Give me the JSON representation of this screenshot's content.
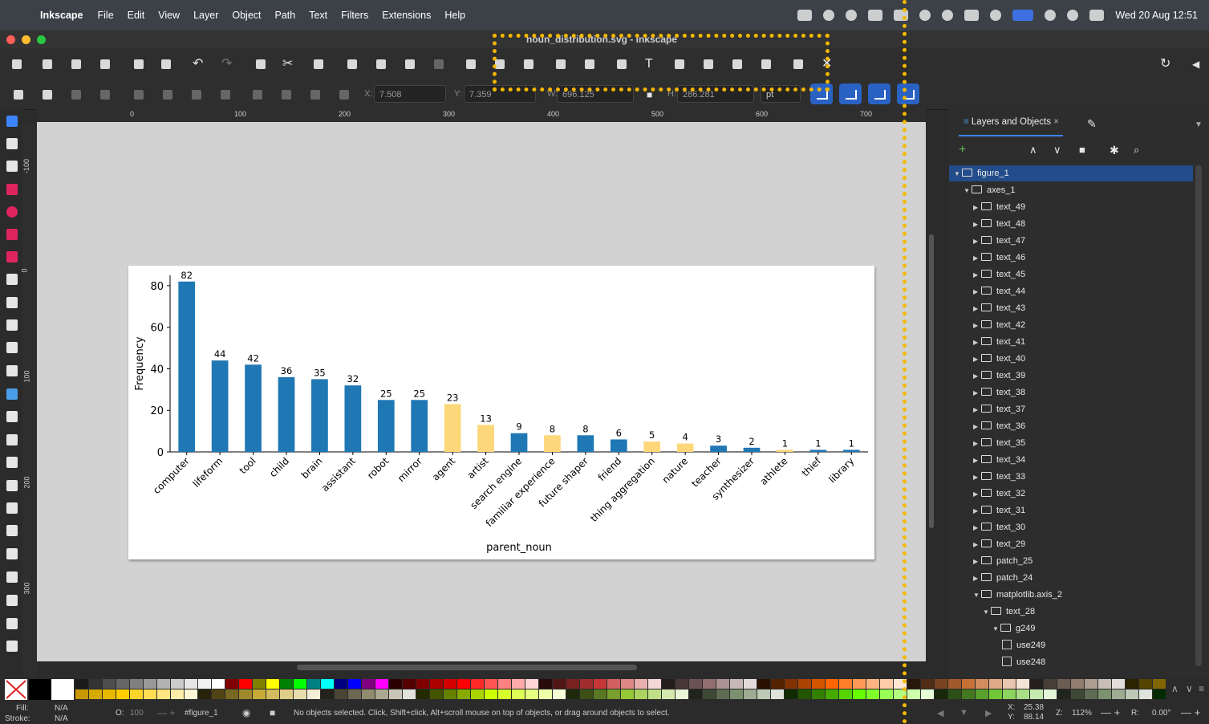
{
  "menubar": {
    "app_name": "Inkscape",
    "items": [
      "File",
      "Edit",
      "View",
      "Layer",
      "Object",
      "Path",
      "Text",
      "Filters",
      "Extensions",
      "Help"
    ],
    "clock": "Wed 20 Aug  12:51"
  },
  "window": {
    "title": "noun_distribution.svg - Inkscape"
  },
  "controls": {
    "x_label": "X:",
    "x_value": "7.508",
    "y_label": "Y:",
    "y_value": "7.359",
    "w_label": "W:",
    "w_value": "696.125",
    "h_label": "H:",
    "h_value": "286.281",
    "unit": "pt"
  },
  "rulers": {
    "top": [
      "0",
      "100",
      "200",
      "300",
      "400",
      "500",
      "600",
      "700"
    ],
    "left": [
      "-100",
      "0",
      "100",
      "200",
      "300"
    ]
  },
  "chart_data": {
    "type": "bar",
    "xlabel": "parent_noun",
    "ylabel": "Frequency",
    "ylim": [
      0,
      85
    ],
    "yticks": [
      0,
      20,
      40,
      60,
      80
    ],
    "grid": false,
    "categories": [
      "computer",
      "lifeform",
      "tool",
      "child",
      "brain",
      "assistant",
      "robot",
      "mirror",
      "agent",
      "artist",
      "search engine",
      "familiar experience",
      "future shaper",
      "friend",
      "thing aggregation",
      "nature",
      "teacher",
      "synthesizer",
      "athlete",
      "thief",
      "library"
    ],
    "values": [
      82,
      44,
      42,
      36,
      35,
      32,
      25,
      25,
      23,
      13,
      9,
      8,
      8,
      6,
      5,
      4,
      3,
      2,
      1,
      1,
      1
    ],
    "bar_colors": [
      "#1f77b4",
      "#1f77b4",
      "#1f77b4",
      "#1f77b4",
      "#1f77b4",
      "#1f77b4",
      "#1f77b4",
      "#1f77b4",
      "#fdd77a",
      "#fdd77a",
      "#1f77b4",
      "#fdd77a",
      "#1f77b4",
      "#1f77b4",
      "#fdd77a",
      "#fdd77a",
      "#1f77b4",
      "#1f77b4",
      "#fdd77a",
      "#1f77b4",
      "#1f77b4"
    ]
  },
  "panel": {
    "tab_label": "Layers and Objects",
    "tree": [
      {
        "label": "figure_1",
        "depth": 0,
        "expanded": true,
        "selected": true,
        "kind": "group"
      },
      {
        "label": "axes_1",
        "depth": 1,
        "expanded": true,
        "kind": "group"
      },
      {
        "label": "text_49",
        "depth": 2,
        "kind": "group"
      },
      {
        "label": "text_48",
        "depth": 2,
        "kind": "group"
      },
      {
        "label": "text_47",
        "depth": 2,
        "kind": "group"
      },
      {
        "label": "text_46",
        "depth": 2,
        "kind": "group"
      },
      {
        "label": "text_45",
        "depth": 2,
        "kind": "group"
      },
      {
        "label": "text_44",
        "depth": 2,
        "kind": "group"
      },
      {
        "label": "text_43",
        "depth": 2,
        "kind": "group"
      },
      {
        "label": "text_42",
        "depth": 2,
        "kind": "group"
      },
      {
        "label": "text_41",
        "depth": 2,
        "kind": "group"
      },
      {
        "label": "text_40",
        "depth": 2,
        "kind": "group"
      },
      {
        "label": "text_39",
        "depth": 2,
        "kind": "group"
      },
      {
        "label": "text_38",
        "depth": 2,
        "kind": "group"
      },
      {
        "label": "text_37",
        "depth": 2,
        "kind": "group"
      },
      {
        "label": "text_36",
        "depth": 2,
        "kind": "group"
      },
      {
        "label": "text_35",
        "depth": 2,
        "kind": "group"
      },
      {
        "label": "text_34",
        "depth": 2,
        "kind": "group"
      },
      {
        "label": "text_33",
        "depth": 2,
        "kind": "group"
      },
      {
        "label": "text_32",
        "depth": 2,
        "kind": "group"
      },
      {
        "label": "text_31",
        "depth": 2,
        "kind": "group"
      },
      {
        "label": "text_30",
        "depth": 2,
        "kind": "group"
      },
      {
        "label": "text_29",
        "depth": 2,
        "kind": "group"
      },
      {
        "label": "patch_25",
        "depth": 2,
        "kind": "group"
      },
      {
        "label": "patch_24",
        "depth": 2,
        "kind": "group"
      },
      {
        "label": "matplotlib.axis_2",
        "depth": 2,
        "expanded": true,
        "kind": "group"
      },
      {
        "label": "text_28",
        "depth": 3,
        "expanded": true,
        "kind": "group"
      },
      {
        "label": "g249",
        "depth": 4,
        "expanded": true,
        "kind": "group"
      },
      {
        "label": "use249",
        "depth": 5,
        "kind": "use"
      },
      {
        "label": "use248",
        "depth": 5,
        "kind": "use"
      }
    ]
  },
  "palette": {
    "row1": [
      "#1a1a1a",
      "#333333",
      "#4d4d4d",
      "#666666",
      "#808080",
      "#999999",
      "#b3b3b3",
      "#cccccc",
      "#e6e6e6",
      "#f2f2f2",
      "#ffffff",
      "#800000",
      "#ff0000",
      "#808000",
      "#ffff00",
      "#008000",
      "#00ff00",
      "#008080",
      "#00ffff",
      "#000080",
      "#0000ff",
      "#800080",
      "#ff00ff",
      "#2b0000",
      "#550000",
      "#800000",
      "#aa0000",
      "#d40000",
      "#ff0000",
      "#ff2a2a",
      "#ff5555",
      "#ff8080",
      "#ffaaaa",
      "#ffd5d5",
      "#280b0b",
      "#501616",
      "#782121",
      "#a02c2c",
      "#c83737",
      "#d35f5f",
      "#de8787",
      "#e9afaf",
      "#f4d7d7",
      "#241c1c",
      "#483737",
      "#6c5353",
      "#916f6f",
      "#ac9393",
      "#c8b7b7",
      "#e3dbdb",
      "#2b1100",
      "#552200",
      "#803300",
      "#aa4400",
      "#d45500",
      "#ff6600",
      "#ff7f2a",
      "#ff9955",
      "#ffb380",
      "#ffccaa",
      "#ffe6d5",
      "#28170b",
      "#502d16",
      "#784421",
      "#a05a2c",
      "#c87137",
      "#d38d5f",
      "#deaa87",
      "#e9c6af",
      "#f4e3d7",
      "#241f1c",
      "#483e37",
      "#6c5d53",
      "#917c6f",
      "#ac9d93",
      "#c8beb7",
      "#e3dedb",
      "#2b2200",
      "#554400",
      "#806600",
      "#aa8800",
      "#d4aa00",
      "#ffcc00"
    ],
    "row2": [
      "#c89600",
      "#d4aa00",
      "#e6b800",
      "#ffcc00",
      "#ffd42a",
      "#ffdd55",
      "#ffe680",
      "#ffeeaa",
      "#fff6d5",
      "#28220b",
      "#504416",
      "#786721",
      "#a0892c",
      "#c8ab37",
      "#d3bc5f",
      "#decd87",
      "#e9ddaf",
      "#f4eed7",
      "#24221c",
      "#484537",
      "#6c6753",
      "#918a6f",
      "#aca793",
      "#c8c4b7",
      "#e3e2db",
      "#222b00",
      "#445500",
      "#668000",
      "#88aa00",
      "#aad400",
      "#ccff00",
      "#d4ff2a",
      "#ddff55",
      "#e5ff80",
      "#eeffaa",
      "#f6ffd5",
      "#1e280b",
      "#3c5016",
      "#5a7821",
      "#78a02c",
      "#96c837",
      "#abd35f",
      "#c0de87",
      "#d5e9af",
      "#eaf4d7",
      "#1f241c",
      "#3e4837",
      "#5d6c53",
      "#7c916f",
      "#9dac93",
      "#bec8b7",
      "#dee3db",
      "#112b00",
      "#225500",
      "#338000",
      "#44aa00",
      "#55d400",
      "#66ff00",
      "#7fff2a",
      "#99ff55",
      "#b3ff80",
      "#ccffaa",
      "#e5ffd5",
      "#17280b",
      "#2d5016",
      "#447821",
      "#5aa02c",
      "#71c837",
      "#8dd35f",
      "#aade87",
      "#c6e9af",
      "#e3f4d7",
      "#1f241c",
      "#3e4837",
      "#5d6c53",
      "#7c916f",
      "#9dac93",
      "#bec8b7",
      "#dee3db",
      "#002b00",
      "#005500",
      "#008000",
      "#00aa00",
      "#00d400",
      "#00ff00"
    ]
  },
  "status": {
    "fill_label": "Fill:",
    "fill_value": "N/A",
    "stroke_label": "Stroke:",
    "stroke_value": "N/A",
    "opacity_label": "O:",
    "opacity_value": "100",
    "layer": "#figure_1",
    "message": "No objects selected. Click, Shift+click, Alt+scroll mouse on top of objects, or drag around objects to select.",
    "x_label": "X:",
    "x_value": "25.38",
    "y_label": "Y:",
    "y_value": "88.14",
    "zoom_label": "Z:",
    "zoom_value": "112%",
    "rotate_label": "R:",
    "rotate_value": "0.00°"
  }
}
